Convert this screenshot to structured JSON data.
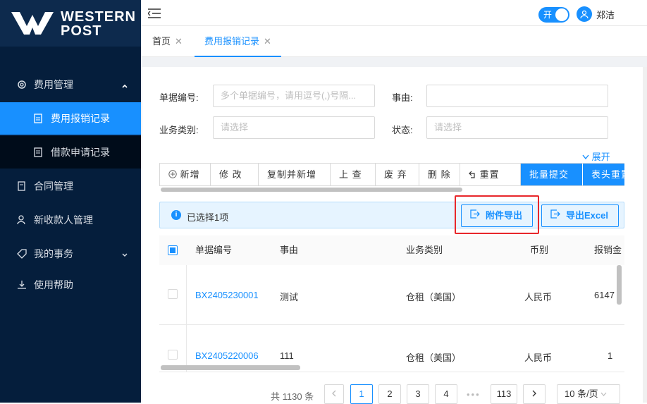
{
  "brand": {
    "line1": "WESTERN",
    "line2": "POST"
  },
  "sidebar": {
    "items": [
      {
        "label": "费用管理",
        "icon": "gear-icon"
      },
      {
        "label": "费用报销记录",
        "icon": "document-icon"
      },
      {
        "label": "借款申请记录",
        "icon": "list-icon"
      },
      {
        "label": "合同管理",
        "icon": "contract-icon"
      },
      {
        "label": "新收款人管理",
        "icon": "user-add-icon"
      },
      {
        "label": "我的事务",
        "icon": "tag-icon"
      },
      {
        "label": "使用帮助",
        "icon": "download-icon"
      }
    ]
  },
  "header": {
    "switch_label": "开",
    "user_name": "郑洁"
  },
  "tabs": [
    {
      "label": "首页"
    },
    {
      "label": "费用报销记录"
    }
  ],
  "filters": {
    "doc_no_label": "单据编号:",
    "doc_no_placeholder": "多个单据编号，请用逗号(,)号隔...",
    "reason_label": "事由:",
    "reason_value": "",
    "biz_type_label": "业务类别:",
    "biz_type_placeholder": "请选择",
    "status_label": "状态:",
    "status_placeholder": "请选择",
    "expand_label": "展开"
  },
  "toolbar": {
    "buttons": [
      "新增",
      "修 改",
      "复制并新增",
      "上 查",
      "废 弃",
      "删 除",
      "重置",
      "批量提交",
      "表头重置"
    ]
  },
  "alert": {
    "text": "已选择1项"
  },
  "actions": {
    "attach_export": "附件导出",
    "excel_export": "导出Excel"
  },
  "table": {
    "columns": [
      "单据编号",
      "事由",
      "业务类别",
      "币别",
      "报销金"
    ],
    "rows": [
      {
        "doc_no": "BX2405230001",
        "reason": "测试",
        "biz_type": "仓租（美国）",
        "currency": "人民币",
        "amount": "6147"
      },
      {
        "doc_no": "BX2405220006",
        "reason": "111",
        "biz_type": "仓租（美国）",
        "currency": "人民币",
        "amount": "1"
      }
    ]
  },
  "pagination": {
    "total": "共 1130 条",
    "pages": [
      "1",
      "2",
      "3",
      "4",
      "113"
    ],
    "current": "1",
    "page_size": "10 条/页"
  },
  "colors": {
    "primary": "#1890ff",
    "sidebar": "#051e3c",
    "highlight": "#e8272b"
  }
}
